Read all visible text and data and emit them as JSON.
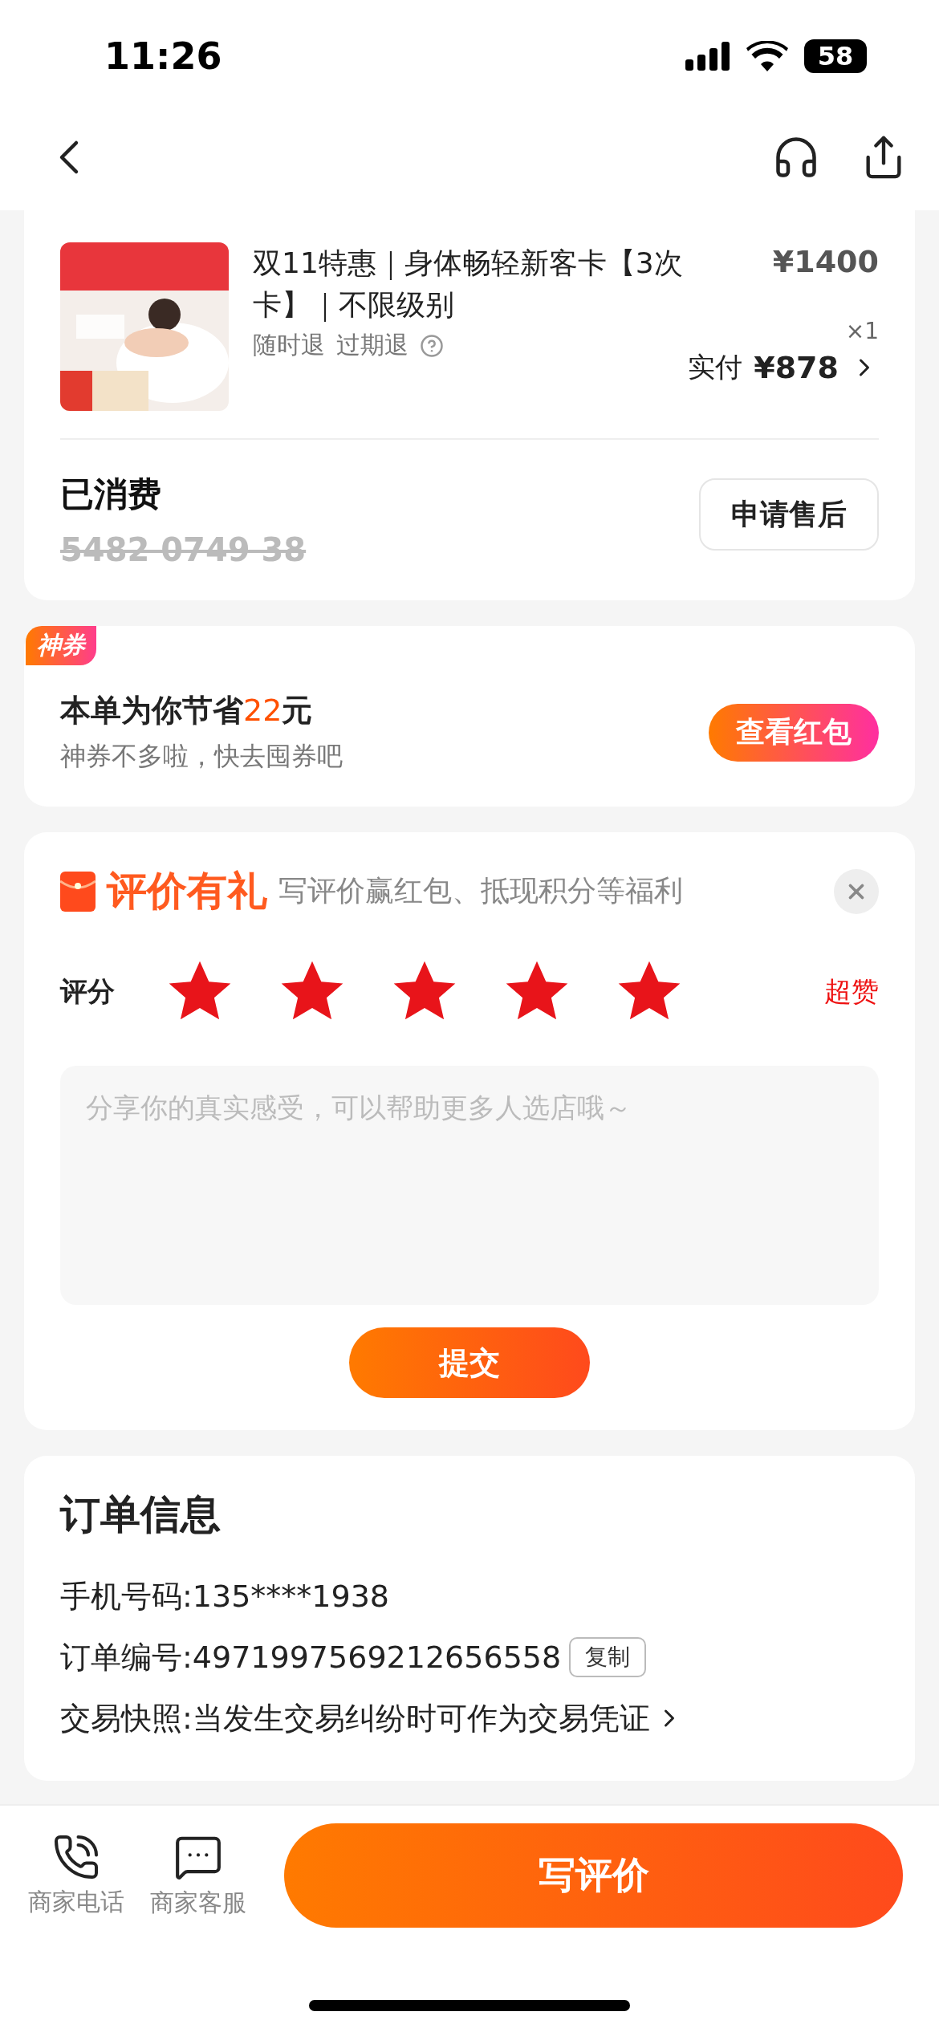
{
  "status_bar": {
    "time": "11:26",
    "battery": "58"
  },
  "product": {
    "title": "双11特惠｜身体畅轻新客卡【3次卡】｜不限级别",
    "price": "¥1400",
    "tags": [
      "随时退",
      "过期退"
    ],
    "quantity": "×1",
    "paid_label": "实付",
    "paid_amount": "¥878"
  },
  "consumption": {
    "status": "已消费",
    "code": "5482 0749 38",
    "button": "申请售后"
  },
  "coupon": {
    "badge": "神券",
    "title_prefix": "本单为你节省",
    "amount": "22",
    "title_suffix": "元",
    "subtitle": "神券不多啦，快去囤券吧",
    "button": "查看红包"
  },
  "review": {
    "title": "评价有礼",
    "subtitle": "写评价赢红包、抵现积分等福利",
    "rating_label": "评分",
    "stars": 5,
    "rating_text": "超赞",
    "placeholder": "分享你的真实感受，可以帮助更多人选店哦～",
    "submit": "提交"
  },
  "order_info": {
    "title": "订单信息",
    "rows": [
      {
        "kind": "text",
        "text": "手机号码:135****1938"
      },
      {
        "kind": "copy",
        "text": "订单编号:4971997569212656558",
        "action": "复制"
      },
      {
        "kind": "link",
        "text": "交易快照:当发生交易纠纷时可作为交易凭证"
      }
    ]
  },
  "bottom_bar": {
    "actions": [
      {
        "kind": "phone",
        "label": "商家电话"
      },
      {
        "kind": "chat",
        "label": "商家客服"
      }
    ],
    "primary": "写评价"
  }
}
